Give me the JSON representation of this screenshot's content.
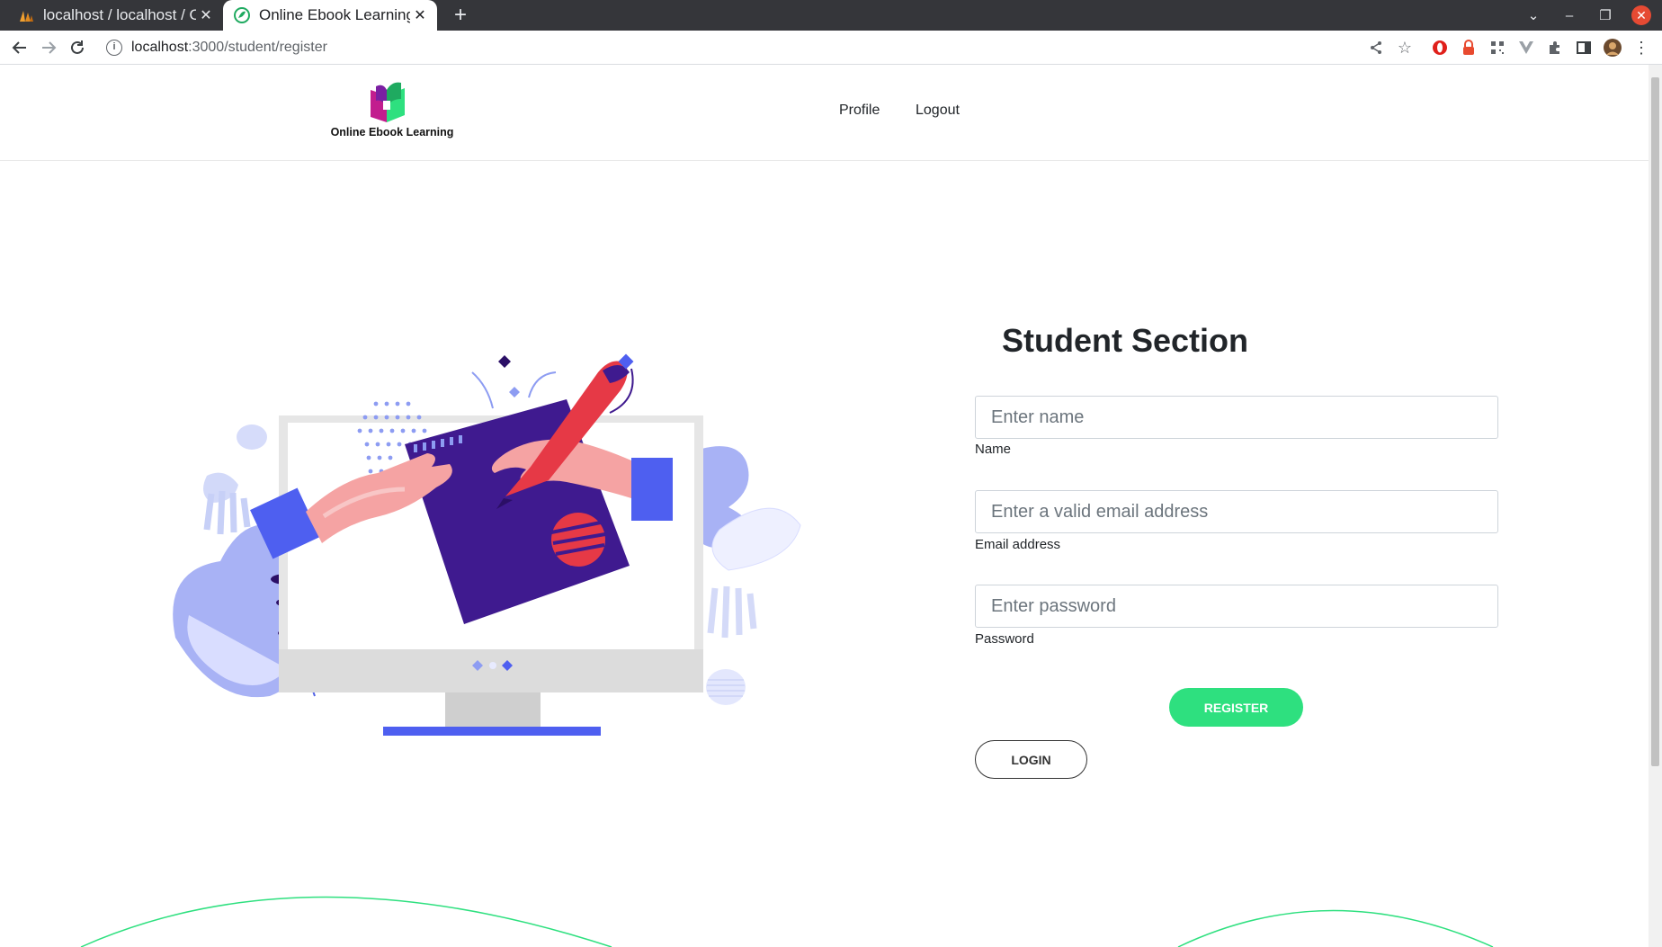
{
  "browser": {
    "tabs": [
      {
        "label": "localhost / localhost / Onl",
        "active": false
      },
      {
        "label": "Online Ebook Learning",
        "active": true
      }
    ],
    "new_tab": "+",
    "url_host": "localhost",
    "url_path": ":3000/student/register"
  },
  "header": {
    "logo_text": "Online Ebook Learning",
    "nav": [
      {
        "label": "Profile"
      },
      {
        "label": "Logout"
      }
    ]
  },
  "form": {
    "title": "Student Section",
    "fields": [
      {
        "placeholder": "Enter name",
        "value": "",
        "label": "Name"
      },
      {
        "placeholder": "Enter a valid email address",
        "value": "",
        "label": "Email address"
      },
      {
        "placeholder": "Enter password",
        "value": "",
        "label": "Password"
      }
    ],
    "register_label": "REGISTER",
    "login_label": "LOGIN"
  },
  "colors": {
    "accent_green": "#2ee07f",
    "illustration_indigo": "#3f1a8f",
    "illustration_blue": "#4e5ff0",
    "pen_red": "#e63946"
  }
}
